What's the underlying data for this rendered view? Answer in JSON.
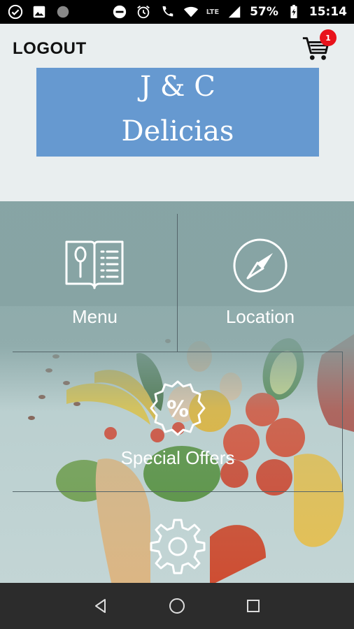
{
  "status_bar": {
    "battery": "57%",
    "time": "15:14",
    "network_1": "LTE",
    "network_2": "LTE"
  },
  "header": {
    "logout_label": "LOGOUT",
    "cart_count": "1",
    "logo_line1": "J & C",
    "logo_line2": "Delicias"
  },
  "tiles": {
    "menu_label": "Menu",
    "location_label": "Location",
    "offers_label": "Special Offers",
    "offers_icon_text": "%"
  },
  "colors": {
    "accent_red": "#e8121b",
    "logo_blue": "#6699d0",
    "tile_bg": "#879ea0"
  }
}
